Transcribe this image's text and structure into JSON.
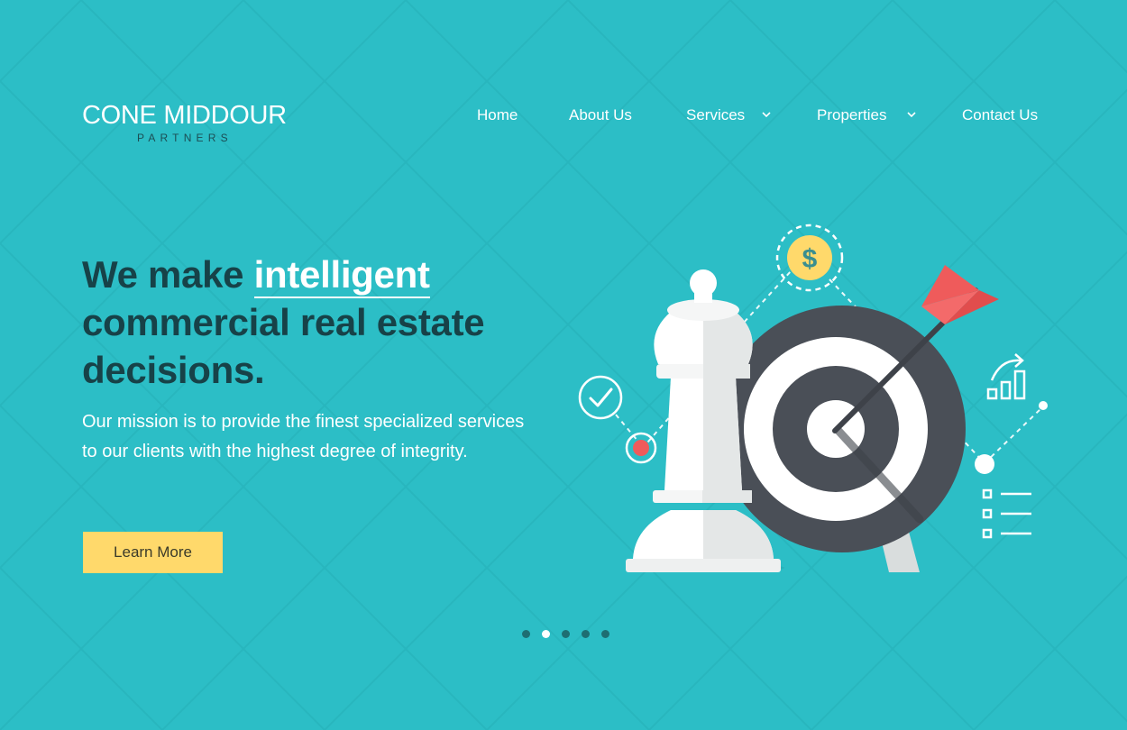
{
  "brand": {
    "name": "CONE MIDDOUR",
    "tagline": "PARTNERS"
  },
  "nav": {
    "items": [
      {
        "label": "Home",
        "dropdown": false
      },
      {
        "label": "About Us",
        "dropdown": false
      },
      {
        "label": "Services",
        "dropdown": true
      },
      {
        "label": "Properties",
        "dropdown": true
      },
      {
        "label": "Contact Us",
        "dropdown": false
      }
    ]
  },
  "hero": {
    "headline_before": "We make ",
    "headline_highlight": "intelligent",
    "headline_after": " commercial real estate decisions.",
    "mission": "Our mission is to provide the finest specialized services to our clients with the highest degree of integrity.",
    "cta_label": "Learn More",
    "illustration_text": {
      "dollar_symbol": "$"
    }
  },
  "carousel": {
    "slide_count": 5,
    "active_index": 1
  },
  "colors": {
    "background": "#2cbec6",
    "headline": "#174248",
    "cta": "#ffd96b",
    "target_dark": "#4a4f57",
    "arrow_red": "#ef5b5b",
    "coin_yellow": "#ffd96b"
  },
  "icons": {
    "target": "target-icon",
    "chess_king": "chess-king-icon",
    "dollar_coin": "dollar-coin-icon",
    "checkmark": "check-circle-icon",
    "growth_chart": "growth-chart-icon",
    "checklist": "checklist-icon"
  }
}
